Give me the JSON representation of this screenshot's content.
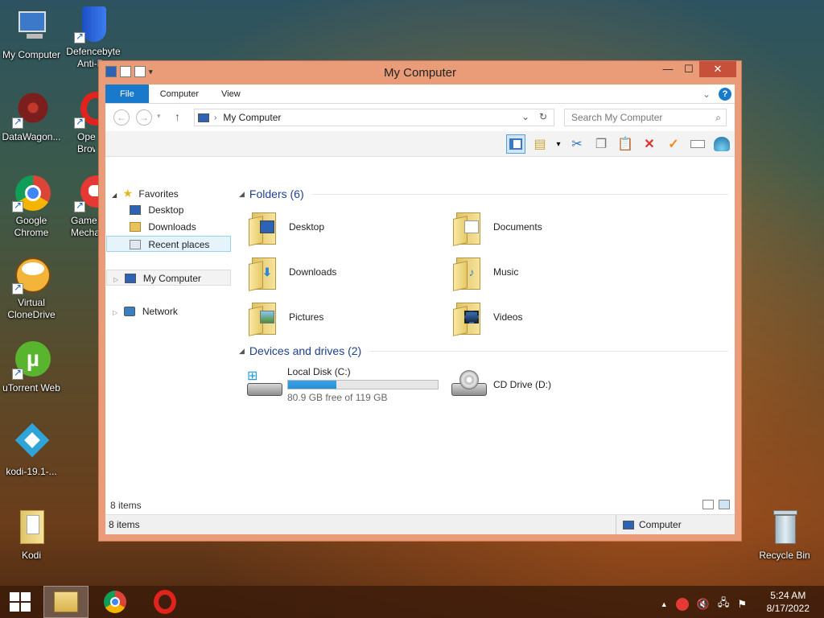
{
  "desktop": {
    "icons": [
      {
        "label": "My Computer"
      },
      {
        "label": "Defencebyte Anti-Ra"
      },
      {
        "label": "DataWagon..."
      },
      {
        "label": "Ope Brow"
      },
      {
        "label": "Google Chrome"
      },
      {
        "label": "Game Mecha"
      },
      {
        "label": "Virtual CloneDrive"
      },
      {
        "label": "uTorrent Web"
      },
      {
        "label": "kodi-19.1-..."
      },
      {
        "label": "Kodi"
      },
      {
        "label": "Recycle Bin"
      }
    ]
  },
  "window": {
    "title": "My Computer",
    "close_glyph": "✕",
    "maximize_glyph": "☐",
    "minimize_glyph": "—"
  },
  "ribbon": {
    "tabs": [
      "File",
      "Computer",
      "View"
    ],
    "help": "?"
  },
  "address": {
    "path": "My Computer",
    "search_placeholder": "Search My Computer"
  },
  "nav": {
    "favorites": "Favorites",
    "desktop": "Desktop",
    "downloads": "Downloads",
    "recent": "Recent places",
    "computer": "My Computer",
    "network": "Network"
  },
  "content": {
    "folders_header": "Folders (6)",
    "folders": [
      {
        "label": "Desktop",
        "icon": "desktop"
      },
      {
        "label": "Documents",
        "icon": "documents"
      },
      {
        "label": "Downloads",
        "icon": "downloads"
      },
      {
        "label": "Music",
        "icon": "music"
      },
      {
        "label": "Pictures",
        "icon": "pictures"
      },
      {
        "label": "Videos",
        "icon": "videos"
      }
    ],
    "drives_header": "Devices and drives (2)",
    "drives": [
      {
        "label": "Local Disk (C:)",
        "free": "80.9 GB free of 119 GB",
        "used_fraction": 0.32
      },
      {
        "label": "CD Drive (D:)"
      }
    ]
  },
  "details_bar": {
    "count": "8 items"
  },
  "status_bar": {
    "count": "8 items",
    "location": "Computer"
  },
  "taskbar": {
    "time": "5:24 AM",
    "date": "8/17/2022"
  },
  "colors": {
    "accent": "#1979ca",
    "window_frame": "#e99c77",
    "close": "#c7503a"
  }
}
